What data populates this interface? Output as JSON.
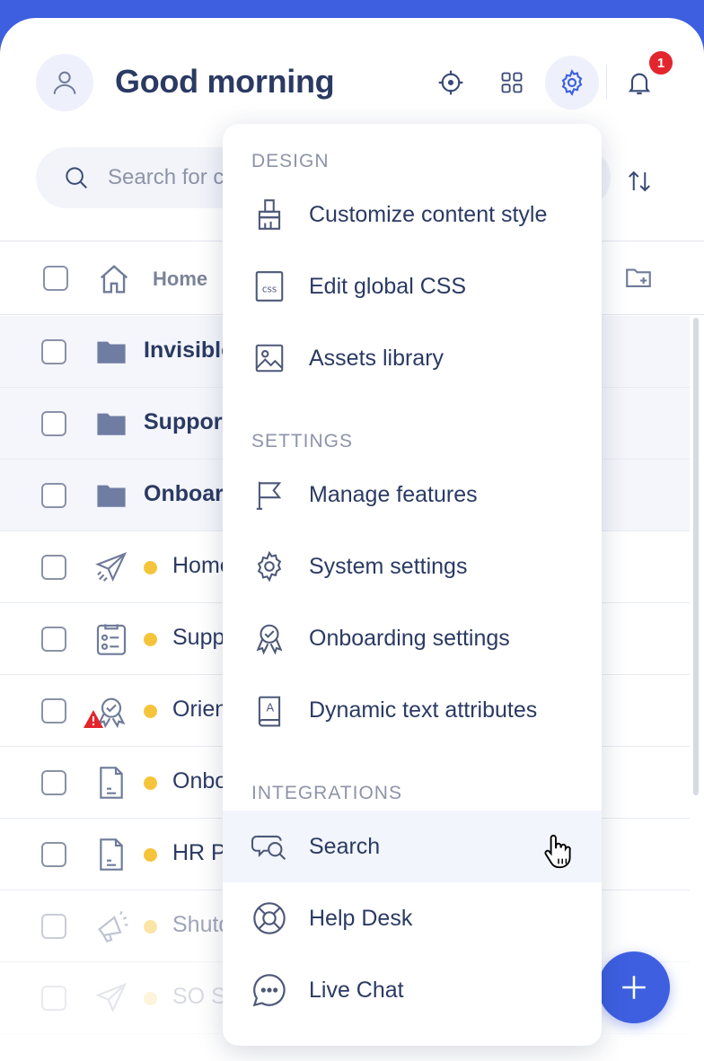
{
  "header": {
    "greeting": "Good morning",
    "notification_count": "1"
  },
  "search": {
    "placeholder": "Search for content"
  },
  "breadcrumb": {
    "home_label": "Home"
  },
  "rows": [
    {
      "type": "folder",
      "label": "Invisible content"
    },
    {
      "type": "folder",
      "label": "Support"
    },
    {
      "type": "folder",
      "label": "Onboarding"
    },
    {
      "type": "item",
      "label": "Home",
      "icon": "paper-plane-icon",
      "status_color": "#f5c43b"
    },
    {
      "type": "item",
      "label": "Support",
      "icon": "checklist-icon",
      "status_color": "#f5c43b"
    },
    {
      "type": "item",
      "label": "Orientation",
      "icon": "badge-check-icon",
      "status_color": "#f5c43b",
      "warning": true
    },
    {
      "type": "item",
      "label": "Onboarding",
      "icon": "document-icon",
      "status_color": "#f5c43b"
    },
    {
      "type": "item",
      "label": "HR Policy",
      "icon": "document-icon",
      "status_color": "#f5c43b"
    },
    {
      "type": "item",
      "label": "Shutdown",
      "icon": "megaphone-icon",
      "status_color": "#f5c43b"
    },
    {
      "type": "item",
      "label": "SO S",
      "icon": "paper-plane-icon",
      "status_color": "#f5c43b"
    }
  ],
  "menu": {
    "sections": [
      {
        "title": "DESIGN",
        "items": [
          {
            "label": "Customize content style",
            "icon": "brush-icon"
          },
          {
            "label": "Edit global CSS",
            "icon": "css-file-icon"
          },
          {
            "label": "Assets library",
            "icon": "image-icon"
          }
        ]
      },
      {
        "title": "SETTINGS",
        "items": [
          {
            "label": "Manage features",
            "icon": "flag-icon"
          },
          {
            "label": "System settings",
            "icon": "gear-icon"
          },
          {
            "label": "Onboarding settings",
            "icon": "badge-check-icon"
          },
          {
            "label": "Dynamic text attributes",
            "icon": "text-book-icon"
          }
        ]
      },
      {
        "title": "INTEGRATIONS",
        "items": [
          {
            "label": "Search",
            "icon": "chat-search-icon",
            "hovered": true
          },
          {
            "label": "Help Desk",
            "icon": "lifebuoy-icon"
          },
          {
            "label": "Live Chat",
            "icon": "chat-bubble-icon"
          }
        ]
      }
    ]
  },
  "colors": {
    "brand": "#3d5fe0",
    "text": "#2b3a63",
    "status_yellow": "#f5c43b",
    "badge_red": "#e3262e"
  }
}
